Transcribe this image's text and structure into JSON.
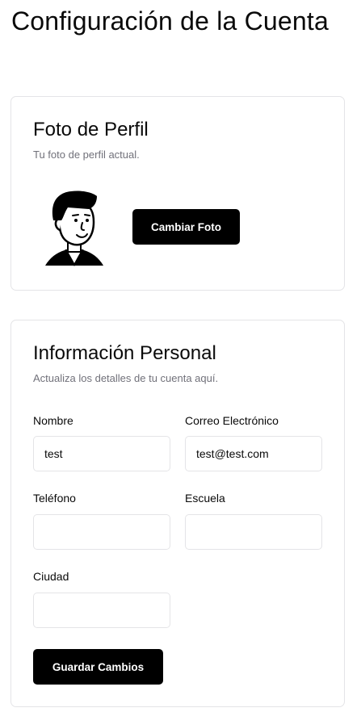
{
  "page": {
    "title": "Configuración de la Cuenta"
  },
  "profile_photo": {
    "title": "Foto de Perfil",
    "description": "Tu foto de perfil actual.",
    "avatar_icon": "cartoon-face-avatar",
    "change_button_label": "Cambiar Foto"
  },
  "personal_info": {
    "title": "Información Personal",
    "description": "Actualiza los detalles de tu cuenta aquí.",
    "fields": {
      "name": {
        "label": "Nombre",
        "value": "test"
      },
      "email": {
        "label": "Correo Electrónico",
        "value": "test@test.com"
      },
      "phone": {
        "label": "Teléfono",
        "value": ""
      },
      "school": {
        "label": "Escuela",
        "value": ""
      },
      "city": {
        "label": "Ciudad",
        "value": ""
      }
    },
    "save_button_label": "Guardar Cambios"
  },
  "colors": {
    "primary_button": "#000000",
    "border": "#e4e4e7",
    "muted_text": "#71717a"
  }
}
